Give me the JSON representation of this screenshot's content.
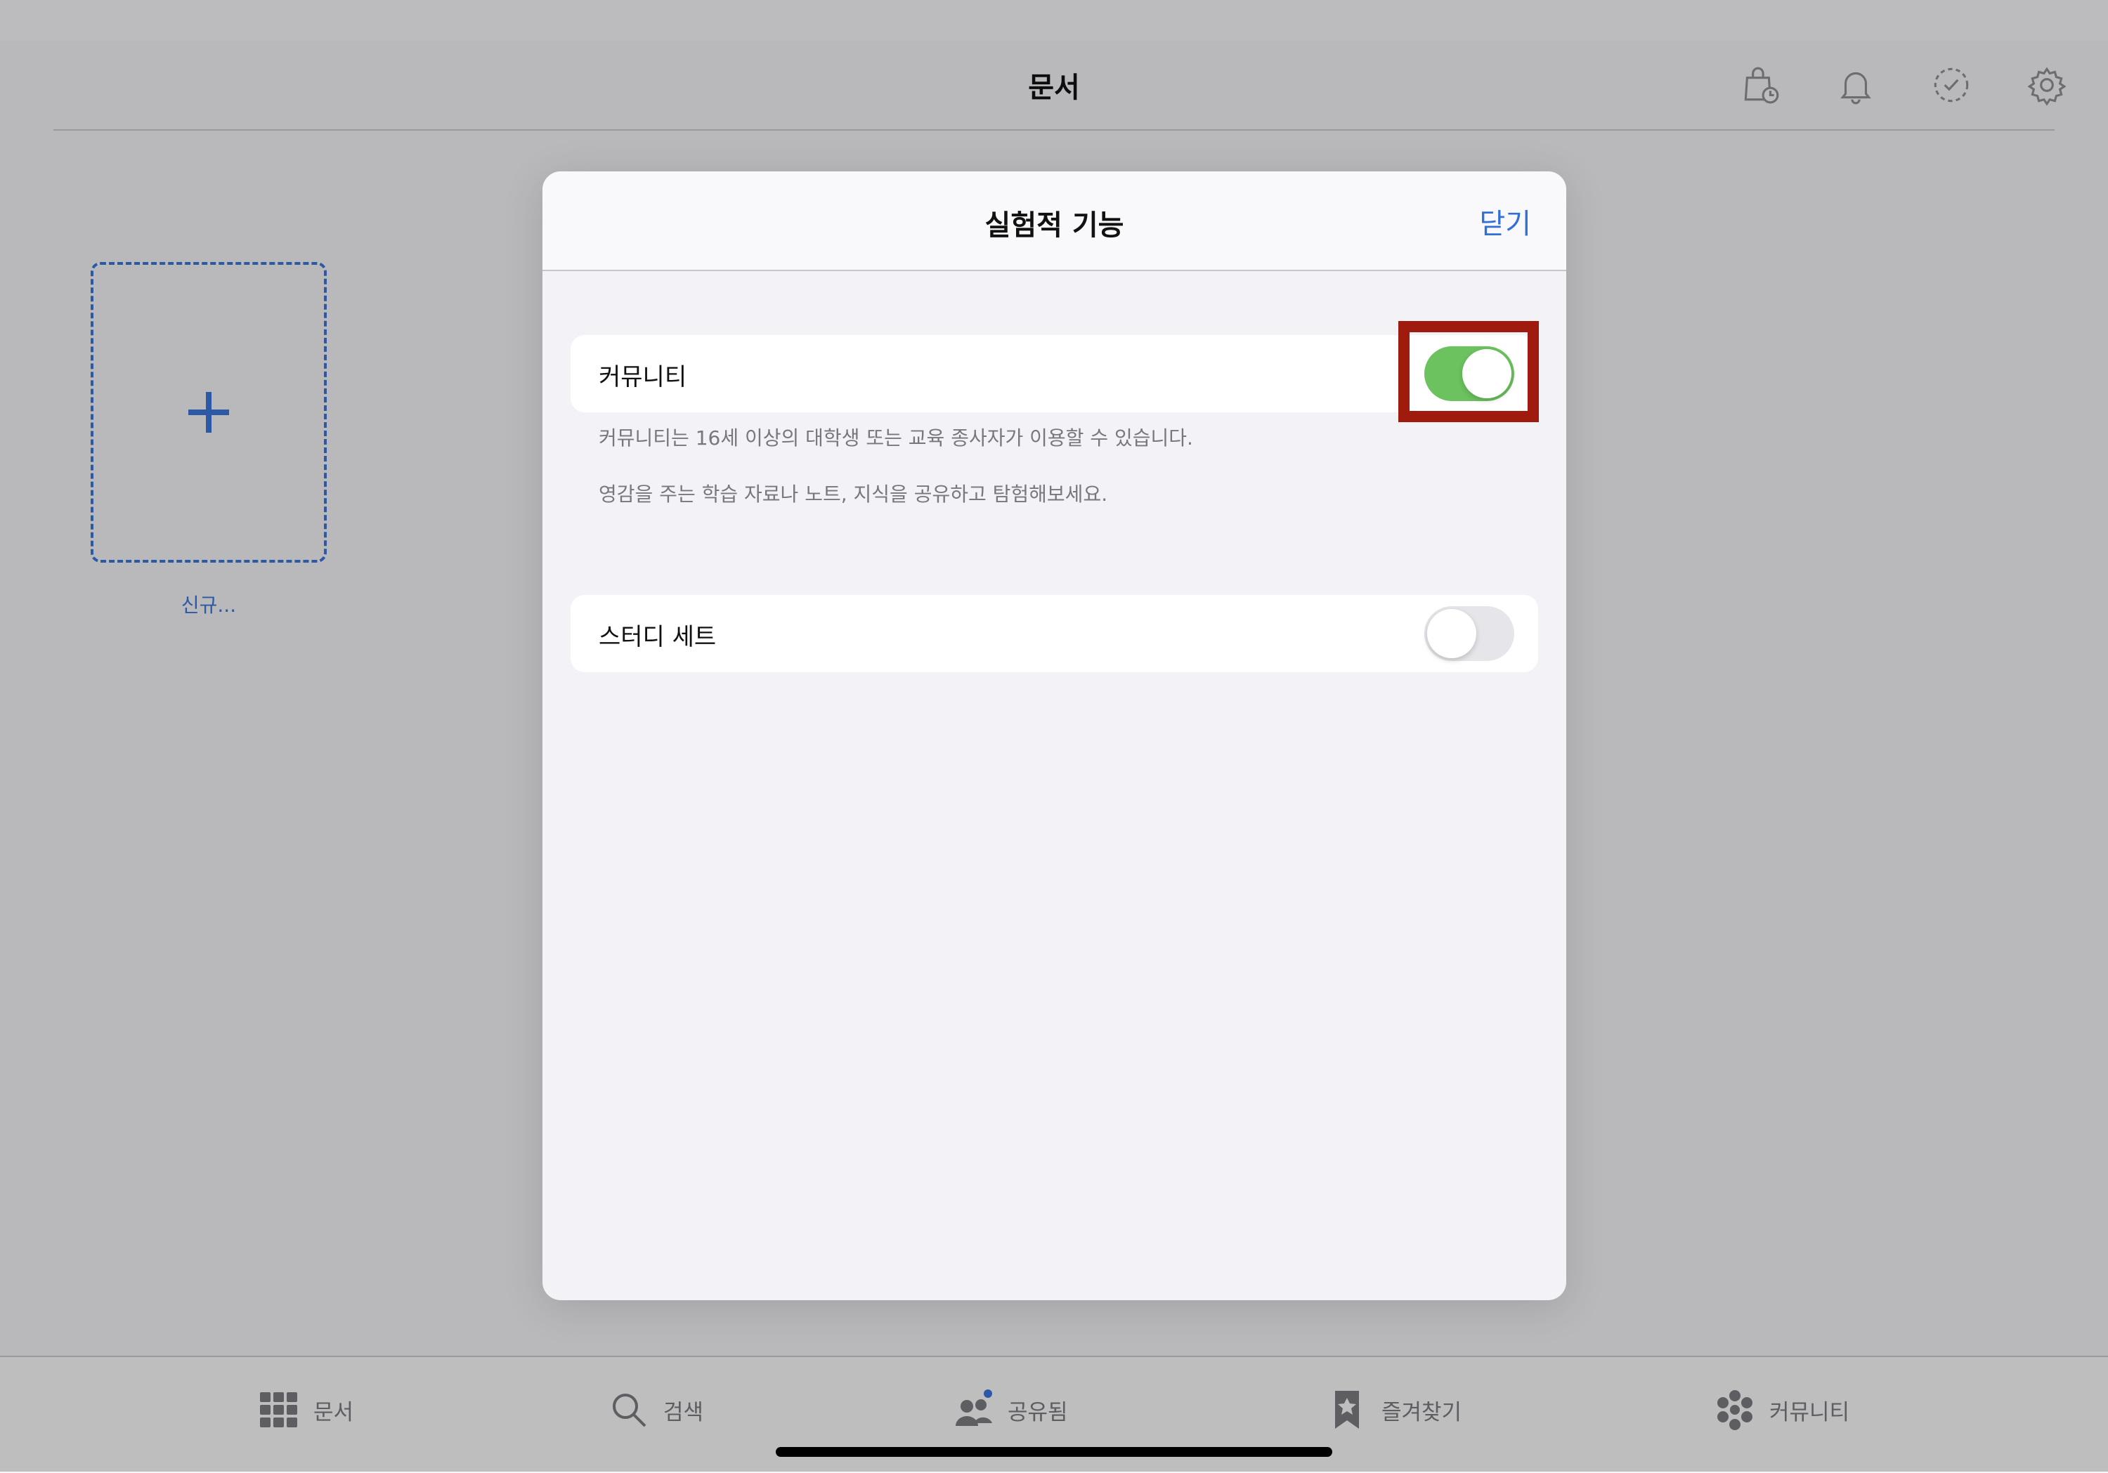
{
  "nav": {
    "title": "문서",
    "icons": [
      "store-icon",
      "bell-icon",
      "check-circle-icon",
      "gear-icon"
    ]
  },
  "library": {
    "new_label": "신규..."
  },
  "modal": {
    "title": "실험적 기능",
    "close_label": "닫기",
    "community": {
      "label": "커뮤니티",
      "enabled": true,
      "footnote_1": "커뮤니티는 16세 이상의 대학생 또는 교육 종사자가 이용할 수 있습니다.",
      "footnote_2": "영감을 주는 학습 자료나 노트, 지식을 공유하고 탐험해보세요."
    },
    "study_sets": {
      "label": "스터디 세트",
      "enabled": false
    }
  },
  "tabbar": {
    "items": [
      {
        "label": "문서",
        "icon": "grid-icon"
      },
      {
        "label": "검색",
        "icon": "search-icon"
      },
      {
        "label": "공유됨",
        "icon": "people-icon"
      },
      {
        "label": "즐겨찾기",
        "icon": "bookmark-star-icon"
      },
      {
        "label": "커뮤니티",
        "icon": "community-icon"
      }
    ]
  },
  "colors": {
    "accent": "#2f6fd6",
    "toggle_on": "#6cc25f",
    "highlight": "#9e1b0e"
  }
}
